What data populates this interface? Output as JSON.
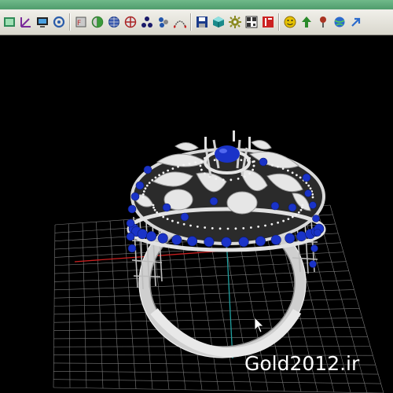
{
  "window": {
    "title_bar_color": "#5fae7c"
  },
  "toolbar": {
    "background": "#e6e4dc",
    "buttons": [
      {
        "name": "render-view-icon",
        "color": "#2e8b57"
      },
      {
        "name": "axis-icon",
        "color": "#7a2a9a"
      },
      {
        "name": "monitor-icon",
        "color": "#1a1a1a"
      },
      {
        "name": "refresh-icon",
        "color": "#2a5caa"
      },
      {
        "name": "layer-icon",
        "color": "#555555"
      },
      {
        "name": "split-view-icon",
        "color": "#2a7a2a"
      },
      {
        "name": "grid-sphere-icon",
        "color": "#1a3a8a"
      },
      {
        "name": "sphere-cross-icon",
        "color": "#aa2222"
      },
      {
        "name": "molecule-icon",
        "color": "#1a1a6a"
      },
      {
        "name": "gem-cluster-icon",
        "color": "#2255aa"
      },
      {
        "name": "curve-icon",
        "color": "#555555"
      },
      {
        "name": "save-icon",
        "color": "#1a3a8a"
      },
      {
        "name": "cube-icon",
        "color": "#1a8a8a"
      },
      {
        "name": "gear-icon",
        "color": "#8a8a22"
      },
      {
        "name": "qr-icon",
        "color": "#333333"
      },
      {
        "name": "book-icon",
        "color": "#cc2222"
      },
      {
        "name": "smiley-icon",
        "color": "#e6c200"
      },
      {
        "name": "arrow-up-icon",
        "color": "#2a8a2a"
      },
      {
        "name": "pin-icon",
        "color": "#aa3322"
      },
      {
        "name": "globe-icon",
        "color": "#2a6acc"
      },
      {
        "name": "arrow-up-right-icon",
        "color": "#2a6acc"
      }
    ]
  },
  "viewport": {
    "background": "#000000",
    "grid_color": "#7a7a7a",
    "x_axis_color": "#cc2020",
    "y_axis_color": "#20a0a0"
  },
  "model": {
    "metal_color": "#d8d8d8",
    "gem_color": "#1a33c8"
  },
  "watermark": {
    "text": "Gold2012.ir"
  }
}
